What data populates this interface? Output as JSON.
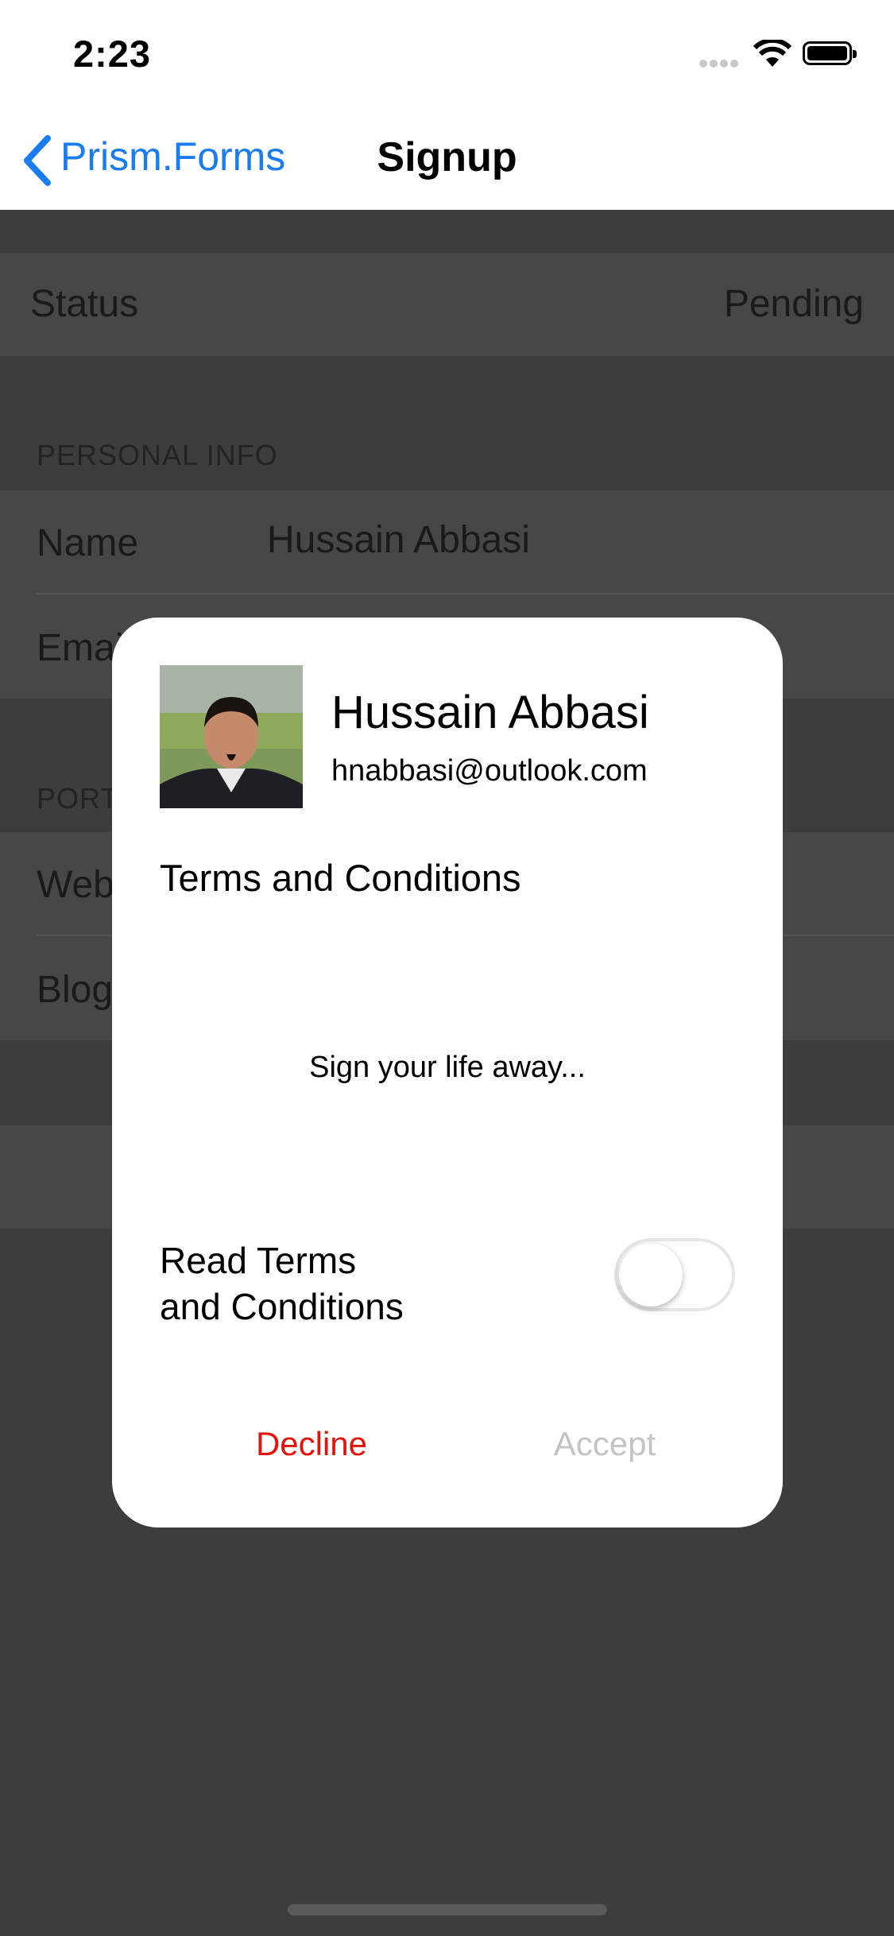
{
  "status_bar": {
    "time": "2:23"
  },
  "nav": {
    "back_label": "Prism.Forms",
    "title": "Signup"
  },
  "table": {
    "status_row": {
      "label": "Status",
      "value": "Pending"
    },
    "personal_info": {
      "header": "PERSONAL INFO",
      "name_label": "Name",
      "name_value": "Hussain Abbasi",
      "email_label_visible": "Emai"
    },
    "portfolio": {
      "header_visible": "PORT",
      "web_label_visible": "Web",
      "blog_label_visible": "Blog"
    }
  },
  "modal": {
    "profile_name": "Hussain Abbasi",
    "profile_email": "hnabbasi@outlook.com",
    "terms_heading": "Terms and Conditions",
    "terms_body": "Sign your life away...",
    "toggle_label_line1": "Read Terms",
    "toggle_label_line2": "and Conditions",
    "toggle_on": false,
    "decline_label": "Decline",
    "accept_label": "Accept"
  },
  "colors": {
    "accent_blue": "#1a7cf1",
    "decline_red": "#e3130c",
    "disabled_gray": "#c4c4c4",
    "overlay": "#3d3d3d"
  }
}
